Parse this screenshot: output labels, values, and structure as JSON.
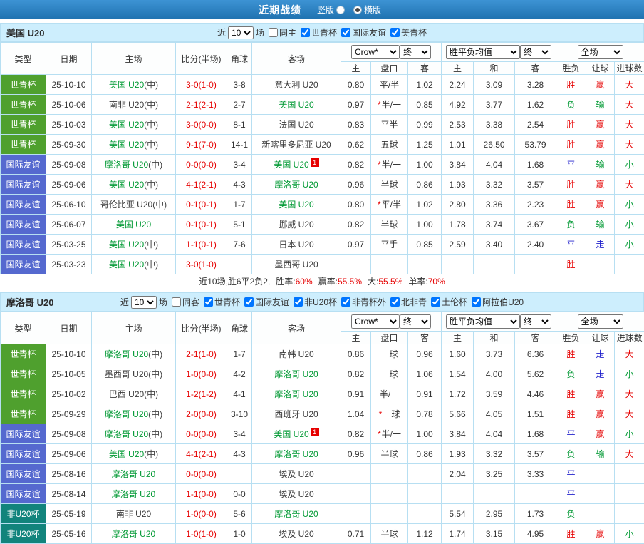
{
  "topbar": {
    "title": "近期战绩",
    "vertical_label": "竖版",
    "horizontal_label": "横版",
    "selected": "横版"
  },
  "table_header": {
    "type": "类型",
    "date": "日期",
    "home": "主场",
    "score": "比分(半场)",
    "corners": "角球",
    "away": "客场",
    "odds_source_select": "Crow*",
    "final_select_1": "终",
    "avg_select": "胜平负均值",
    "final_select_2": "终",
    "scope_select": "全场",
    "sub": [
      "主",
      "盘口",
      "客",
      "主",
      "和",
      "客",
      "胜负",
      "让球",
      "进球数"
    ]
  },
  "colors": {
    "topbar_blue": "#2c80c4",
    "section_header_blue": "#cdeefd",
    "grid_border_blue": "#b7dff2",
    "highlight_team_green": "#009933",
    "score_red": "#e60000",
    "result_win_red": "#e60000",
    "result_loss_green": "#009933",
    "result_draw_blue": "#2323cc",
    "type_worldcup_green": "#4fa02e",
    "type_friendly_blue": "#5569cf",
    "type_africa_teal": "#12847c"
  },
  "sections": [
    {
      "team": "美国 U20",
      "filters": {
        "recent_label": "近",
        "count": "10",
        "unit": "场",
        "checkboxes": [
          {
            "label": "同主",
            "checked": false
          },
          {
            "label": "世青杯",
            "checked": true
          },
          {
            "label": "国际友谊",
            "checked": true
          },
          {
            "label": "美青杯",
            "checked": true
          }
        ]
      },
      "rows": [
        {
          "type": "世青杯",
          "type_class": "green",
          "date": "25-10-10",
          "home": "美国 U20",
          "home_suffix": "(中)",
          "home_hl": true,
          "home_badge": "",
          "score": "3-0(1-0)",
          "corners": "3-8",
          "away": "意大利 U20",
          "away_suffix": "",
          "away_hl": false,
          "away_badge": "",
          "odds_home": "0.80",
          "handicap": "平/半",
          "handicap_star": false,
          "odds_away": "1.02",
          "avg_home": "2.24",
          "avg_draw": "3.09",
          "avg_away": "3.28",
          "res_outcome": "胜",
          "res_outcome_color": "red",
          "res_handicap": "赢",
          "res_handicap_color": "red",
          "res_goals": "大",
          "res_goals_color": "red"
        },
        {
          "type": "世青杯",
          "type_class": "green",
          "date": "25-10-06",
          "home": "南非 U20",
          "home_suffix": "(中)",
          "home_hl": false,
          "home_badge": "",
          "score": "2-1(2-1)",
          "corners": "2-7",
          "away": "美国 U20",
          "away_suffix": "",
          "away_hl": true,
          "away_badge": "",
          "odds_home": "0.97",
          "handicap": "半/一",
          "handicap_star": true,
          "odds_away": "0.85",
          "avg_home": "4.92",
          "avg_draw": "3.77",
          "avg_away": "1.62",
          "res_outcome": "负",
          "res_outcome_color": "green",
          "res_handicap": "输",
          "res_handicap_color": "green",
          "res_goals": "大",
          "res_goals_color": "red"
        },
        {
          "type": "世青杯",
          "type_class": "green",
          "date": "25-10-03",
          "home": "美国 U20",
          "home_suffix": "(中)",
          "home_hl": true,
          "home_badge": "",
          "score": "3-0(0-0)",
          "corners": "8-1",
          "away": "法国 U20",
          "away_suffix": "",
          "away_hl": false,
          "away_badge": "",
          "odds_home": "0.83",
          "handicap": "平半",
          "handicap_star": false,
          "odds_away": "0.99",
          "avg_home": "2.53",
          "avg_draw": "3.38",
          "avg_away": "2.54",
          "res_outcome": "胜",
          "res_outcome_color": "red",
          "res_handicap": "赢",
          "res_handicap_color": "red",
          "res_goals": "大",
          "res_goals_color": "red"
        },
        {
          "type": "世青杯",
          "type_class": "green",
          "date": "25-09-30",
          "home": "美国 U20",
          "home_suffix": "(中)",
          "home_hl": true,
          "home_badge": "",
          "score": "9-1(7-0)",
          "corners": "14-1",
          "away": "新喀里多尼亚 U20",
          "away_suffix": "",
          "away_hl": false,
          "away_badge": "",
          "odds_home": "0.62",
          "handicap": "五球",
          "handicap_star": false,
          "odds_away": "1.25",
          "avg_home": "1.01",
          "avg_draw": "26.50",
          "avg_away": "53.79",
          "res_outcome": "胜",
          "res_outcome_color": "red",
          "res_handicap": "赢",
          "res_handicap_color": "red",
          "res_goals": "大",
          "res_goals_color": "red"
        },
        {
          "type": "国际友谊",
          "type_class": "blue",
          "date": "25-09-08",
          "home": "摩洛哥 U20",
          "home_suffix": "(中)",
          "home_hl": true,
          "home_badge": "",
          "score": "0-0(0-0)",
          "corners": "3-4",
          "away": "美国 U20",
          "away_suffix": "",
          "away_hl": true,
          "away_badge": "1",
          "odds_home": "0.82",
          "handicap": "半/一",
          "handicap_star": true,
          "odds_away": "1.00",
          "avg_home": "3.84",
          "avg_draw": "4.04",
          "avg_away": "1.68",
          "res_outcome": "平",
          "res_outcome_color": "blue",
          "res_handicap": "输",
          "res_handicap_color": "green",
          "res_goals": "小",
          "res_goals_color": "green"
        },
        {
          "type": "国际友谊",
          "type_class": "blue",
          "date": "25-09-06",
          "home": "美国 U20",
          "home_suffix": "(中)",
          "home_hl": true,
          "home_badge": "",
          "score": "4-1(2-1)",
          "corners": "4-3",
          "away": "摩洛哥 U20",
          "away_suffix": "",
          "away_hl": true,
          "away_badge": "",
          "odds_home": "0.96",
          "handicap": "半球",
          "handicap_star": false,
          "odds_away": "0.86",
          "avg_home": "1.93",
          "avg_draw": "3.32",
          "avg_away": "3.57",
          "res_outcome": "胜",
          "res_outcome_color": "red",
          "res_handicap": "赢",
          "res_handicap_color": "red",
          "res_goals": "大",
          "res_goals_color": "red"
        },
        {
          "type": "国际友谊",
          "type_class": "blue",
          "date": "25-06-10",
          "home": "哥伦比亚 U20",
          "home_suffix": "(中)",
          "home_hl": false,
          "home_badge": "",
          "score": "0-1(0-1)",
          "corners": "1-7",
          "away": "美国 U20",
          "away_suffix": "",
          "away_hl": true,
          "away_badge": "",
          "odds_home": "0.80",
          "handicap": "平/半",
          "handicap_star": true,
          "odds_away": "1.02",
          "avg_home": "2.80",
          "avg_draw": "3.36",
          "avg_away": "2.23",
          "res_outcome": "胜",
          "res_outcome_color": "red",
          "res_handicap": "赢",
          "res_handicap_color": "red",
          "res_goals": "小",
          "res_goals_color": "green"
        },
        {
          "type": "国际友谊",
          "type_class": "blue",
          "date": "25-06-07",
          "home": "美国 U20",
          "home_suffix": "",
          "home_hl": true,
          "home_badge": "",
          "score": "0-1(0-1)",
          "corners": "5-1",
          "away": "挪威 U20",
          "away_suffix": "",
          "away_hl": false,
          "away_badge": "",
          "odds_home": "0.82",
          "handicap": "半球",
          "handicap_star": false,
          "odds_away": "1.00",
          "avg_home": "1.78",
          "avg_draw": "3.74",
          "avg_away": "3.67",
          "res_outcome": "负",
          "res_outcome_color": "green",
          "res_handicap": "输",
          "res_handicap_color": "green",
          "res_goals": "小",
          "res_goals_color": "green"
        },
        {
          "type": "国际友谊",
          "type_class": "blue",
          "date": "25-03-25",
          "home": "美国 U20",
          "home_suffix": "(中)",
          "home_hl": true,
          "home_badge": "",
          "score": "1-1(0-1)",
          "corners": "7-6",
          "away": "日本 U20",
          "away_suffix": "",
          "away_hl": false,
          "away_badge": "",
          "odds_home": "0.97",
          "handicap": "平手",
          "handicap_star": false,
          "odds_away": "0.85",
          "avg_home": "2.59",
          "avg_draw": "3.40",
          "avg_away": "2.40",
          "res_outcome": "平",
          "res_outcome_color": "blue",
          "res_handicap": "走",
          "res_handicap_color": "blue",
          "res_goals": "小",
          "res_goals_color": "green"
        },
        {
          "type": "国际友谊",
          "type_class": "blue",
          "date": "25-03-23",
          "home": "美国 U20",
          "home_suffix": "(中)",
          "home_hl": true,
          "home_badge": "",
          "score": "3-0(1-0)",
          "corners": "",
          "away": "墨西哥 U20",
          "away_suffix": "",
          "away_hl": false,
          "away_badge": "",
          "odds_home": "",
          "handicap": "",
          "handicap_star": false,
          "odds_away": "",
          "avg_home": "",
          "avg_draw": "",
          "avg_away": "",
          "res_outcome": "胜",
          "res_outcome_color": "red",
          "res_handicap": "",
          "res_handicap_color": "",
          "res_goals": "",
          "res_goals_color": ""
        }
      ],
      "footer": {
        "summary": "近10场,胜6平2负2,",
        "stats": [
          {
            "label": "胜率:",
            "value": "60%"
          },
          {
            "label": "赢率:",
            "value": "55.5%"
          },
          {
            "label": "大:",
            "value": "55.5%"
          },
          {
            "label": "单率:",
            "value": "70%"
          }
        ]
      }
    },
    {
      "team": "摩洛哥 U20",
      "filters": {
        "recent_label": "近",
        "count": "10",
        "unit": "场",
        "checkboxes": [
          {
            "label": "同客",
            "checked": false
          },
          {
            "label": "世青杯",
            "checked": true
          },
          {
            "label": "国际友谊",
            "checked": true
          },
          {
            "label": "非U20杯",
            "checked": true
          },
          {
            "label": "非青杯外",
            "checked": true
          },
          {
            "label": "北非青",
            "checked": true
          },
          {
            "label": "土伦杯",
            "checked": true
          },
          {
            "label": "阿拉伯U20",
            "checked": true
          }
        ]
      },
      "rows": [
        {
          "type": "世青杯",
          "type_class": "green",
          "date": "25-10-10",
          "home": "摩洛哥 U20",
          "home_suffix": "(中)",
          "home_hl": true,
          "home_badge": "",
          "score": "2-1(1-0)",
          "corners": "1-7",
          "away": "南韩 U20",
          "away_suffix": "",
          "away_hl": false,
          "away_badge": "",
          "odds_home": "0.86",
          "handicap": "一球",
          "handicap_star": false,
          "odds_away": "0.96",
          "avg_home": "1.60",
          "avg_draw": "3.73",
          "avg_away": "6.36",
          "res_outcome": "胜",
          "res_outcome_color": "red",
          "res_handicap": "走",
          "res_handicap_color": "blue",
          "res_goals": "大",
          "res_goals_color": "red"
        },
        {
          "type": "世青杯",
          "type_class": "green",
          "date": "25-10-05",
          "home": "墨西哥 U20",
          "home_suffix": "(中)",
          "home_hl": false,
          "home_badge": "",
          "score": "1-0(0-0)",
          "corners": "4-2",
          "away": "摩洛哥 U20",
          "away_suffix": "",
          "away_hl": true,
          "away_badge": "",
          "odds_home": "0.82",
          "handicap": "一球",
          "handicap_star": false,
          "odds_away": "1.06",
          "avg_home": "1.54",
          "avg_draw": "4.00",
          "avg_away": "5.62",
          "res_outcome": "负",
          "res_outcome_color": "green",
          "res_handicap": "走",
          "res_handicap_color": "blue",
          "res_goals": "小",
          "res_goals_color": "green"
        },
        {
          "type": "世青杯",
          "type_class": "green",
          "date": "25-10-02",
          "home": "巴西 U20",
          "home_suffix": "(中)",
          "home_hl": false,
          "home_badge": "",
          "score": "1-2(1-2)",
          "corners": "4-1",
          "away": "摩洛哥 U20",
          "away_suffix": "",
          "away_hl": true,
          "away_badge": "",
          "odds_home": "0.91",
          "handicap": "半/一",
          "handicap_star": false,
          "odds_away": "0.91",
          "avg_home": "1.72",
          "avg_draw": "3.59",
          "avg_away": "4.46",
          "res_outcome": "胜",
          "res_outcome_color": "red",
          "res_handicap": "赢",
          "res_handicap_color": "red",
          "res_goals": "大",
          "res_goals_color": "red"
        },
        {
          "type": "世青杯",
          "type_class": "green",
          "date": "25-09-29",
          "home": "摩洛哥 U20",
          "home_suffix": "(中)",
          "home_hl": true,
          "home_badge": "",
          "score": "2-0(0-0)",
          "corners": "3-10",
          "away": "西班牙 U20",
          "away_suffix": "",
          "away_hl": false,
          "away_badge": "",
          "odds_home": "1.04",
          "handicap": "一球",
          "handicap_star": true,
          "odds_away": "0.78",
          "avg_home": "5.66",
          "avg_draw": "4.05",
          "avg_away": "1.51",
          "res_outcome": "胜",
          "res_outcome_color": "red",
          "res_handicap": "赢",
          "res_handicap_color": "red",
          "res_goals": "大",
          "res_goals_color": "red"
        },
        {
          "type": "国际友谊",
          "type_class": "blue",
          "date": "25-09-08",
          "home": "摩洛哥 U20",
          "home_suffix": "(中)",
          "home_hl": true,
          "home_badge": "",
          "score": "0-0(0-0)",
          "corners": "3-4",
          "away": "美国 U20",
          "away_suffix": "",
          "away_hl": true,
          "away_badge": "1",
          "odds_home": "0.82",
          "handicap": "半/一",
          "handicap_star": true,
          "odds_away": "1.00",
          "avg_home": "3.84",
          "avg_draw": "4.04",
          "avg_away": "1.68",
          "res_outcome": "平",
          "res_outcome_color": "blue",
          "res_handicap": "赢",
          "res_handicap_color": "red",
          "res_goals": "小",
          "res_goals_color": "green"
        },
        {
          "type": "国际友谊",
          "type_class": "blue",
          "date": "25-09-06",
          "home": "美国 U20",
          "home_suffix": "(中)",
          "home_hl": true,
          "home_badge": "",
          "score": "4-1(2-1)",
          "corners": "4-3",
          "away": "摩洛哥 U20",
          "away_suffix": "",
          "away_hl": true,
          "away_badge": "",
          "odds_home": "0.96",
          "handicap": "半球",
          "handicap_star": false,
          "odds_away": "0.86",
          "avg_home": "1.93",
          "avg_draw": "3.32",
          "avg_away": "3.57",
          "res_outcome": "负",
          "res_outcome_color": "green",
          "res_handicap": "输",
          "res_handicap_color": "green",
          "res_goals": "大",
          "res_goals_color": "red"
        },
        {
          "type": "国际友谊",
          "type_class": "blue",
          "date": "25-08-16",
          "home": "摩洛哥 U20",
          "home_suffix": "",
          "home_hl": true,
          "home_badge": "",
          "score": "0-0(0-0)",
          "corners": "",
          "away": "埃及 U20",
          "away_suffix": "",
          "away_hl": false,
          "away_badge": "",
          "odds_home": "",
          "handicap": "",
          "handicap_star": false,
          "odds_away": "",
          "avg_home": "2.04",
          "avg_draw": "3.25",
          "avg_away": "3.33",
          "res_outcome": "平",
          "res_outcome_color": "blue",
          "res_handicap": "",
          "res_handicap_color": "",
          "res_goals": "",
          "res_goals_color": ""
        },
        {
          "type": "国际友谊",
          "type_class": "blue",
          "date": "25-08-14",
          "home": "摩洛哥 U20",
          "home_suffix": "",
          "home_hl": true,
          "home_badge": "",
          "score": "1-1(0-0)",
          "corners": "0-0",
          "away": "埃及 U20",
          "away_suffix": "",
          "away_hl": false,
          "away_badge": "",
          "odds_home": "",
          "handicap": "",
          "handicap_star": false,
          "odds_away": "",
          "avg_home": "",
          "avg_draw": "",
          "avg_away": "",
          "res_outcome": "平",
          "res_outcome_color": "blue",
          "res_handicap": "",
          "res_handicap_color": "",
          "res_goals": "",
          "res_goals_color": ""
        },
        {
          "type": "非U20杯",
          "type_class": "teal",
          "date": "25-05-19",
          "home": "南非 U20",
          "home_suffix": "",
          "home_hl": false,
          "home_badge": "",
          "score": "1-0(0-0)",
          "corners": "5-6",
          "away": "摩洛哥 U20",
          "away_suffix": "",
          "away_hl": true,
          "away_badge": "",
          "odds_home": "",
          "handicap": "",
          "handicap_star": false,
          "odds_away": "",
          "avg_home": "5.54",
          "avg_draw": "2.95",
          "avg_away": "1.73",
          "res_outcome": "负",
          "res_outcome_color": "green",
          "res_handicap": "",
          "res_handicap_color": "",
          "res_goals": "",
          "res_goals_color": ""
        },
        {
          "type": "非U20杯",
          "type_class": "teal",
          "date": "25-05-16",
          "home": "摩洛哥 U20",
          "home_suffix": "",
          "home_hl": true,
          "home_badge": "",
          "score": "1-0(1-0)",
          "corners": "1-0",
          "away": "埃及 U20",
          "away_suffix": "",
          "away_hl": false,
          "away_badge": "",
          "odds_home": "0.71",
          "handicap": "半球",
          "handicap_star": false,
          "odds_away": "1.12",
          "avg_home": "1.74",
          "avg_draw": "3.15",
          "avg_away": "4.95",
          "res_outcome": "胜",
          "res_outcome_color": "red",
          "res_handicap": "赢",
          "res_handicap_color": "red",
          "res_goals": "小",
          "res_goals_color": "green"
        }
      ]
    }
  ]
}
